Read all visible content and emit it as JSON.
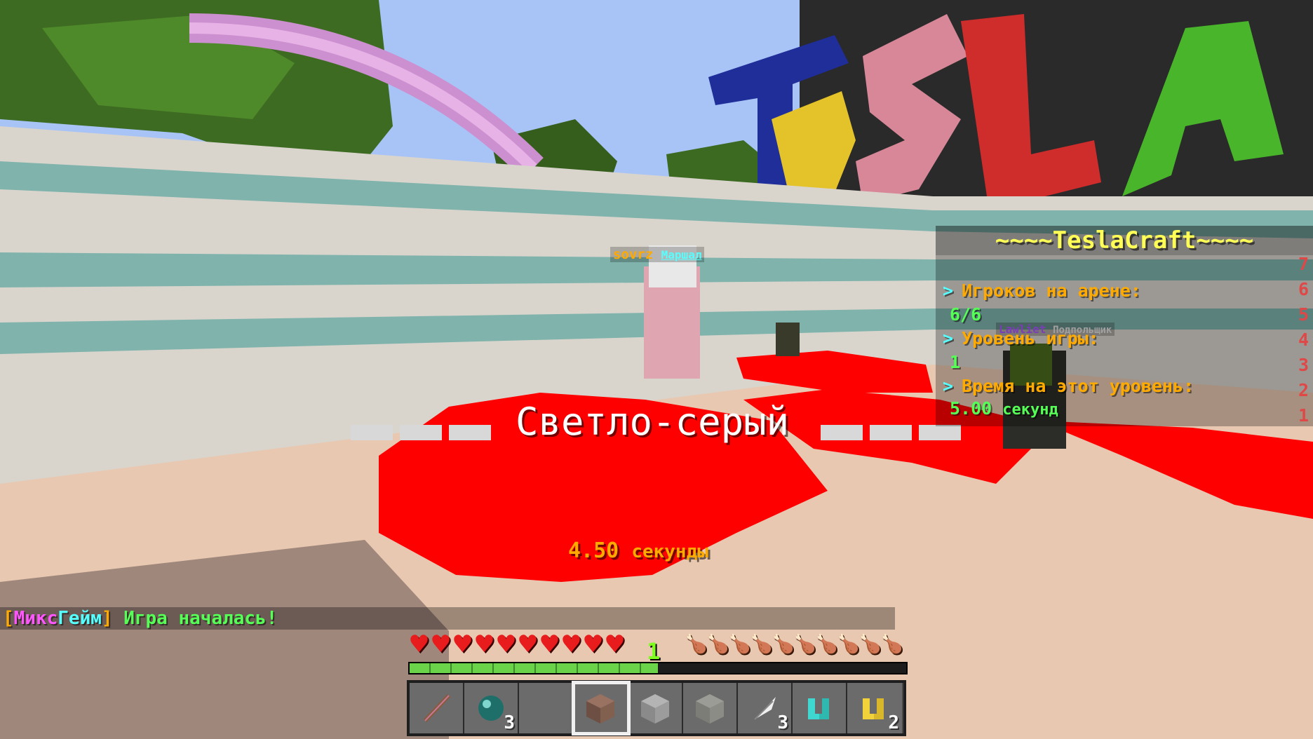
{
  "world": {
    "nametags": {
      "player1_name": "sovrz",
      "player1_title": "Маршал",
      "player2_name": "Lawliet",
      "player2_title": "Подпольщик"
    }
  },
  "title_overlay": {
    "color_title": "Светло-серый",
    "timer_value": "4.50",
    "timer_unit": "секунды"
  },
  "scoreboard": {
    "title": "~~~~TeslaCraft~~~~",
    "lines": [
      {
        "text": "Игроков на арене:",
        "score": "7",
        "arrow": true
      },
      {
        "text": "6/6",
        "score": "6",
        "arrow": false
      },
      {
        "text": "Уровень игры:",
        "score": "5",
        "arrow": true
      },
      {
        "text": "1",
        "score": "4",
        "arrow": false
      },
      {
        "text": "Время на этот уровень:",
        "score": "3",
        "arrow": true
      },
      {
        "text_value": "5.00",
        "text_unit": "секунд",
        "score": "2",
        "arrow": false
      },
      {
        "text": "",
        "score": "1",
        "arrow": false
      }
    ]
  },
  "chat": {
    "prefix_open": "[",
    "prefix_part1": "Микс",
    "prefix_part2": "Гейм",
    "prefix_close": "]",
    "message": " Игра началась!"
  },
  "hud": {
    "hearts": 10,
    "food": 10,
    "xp_level": "1",
    "xp_progress": 0.5,
    "hotbar": [
      {
        "item": "stick",
        "count": ""
      },
      {
        "item": "ender-pearl",
        "count": "3"
      },
      {
        "item": "empty",
        "count": ""
      },
      {
        "item": "brown-terracotta",
        "count": "",
        "selected": true
      },
      {
        "item": "stone-block",
        "count": ""
      },
      {
        "item": "light-gray-block",
        "count": ""
      },
      {
        "item": "feather",
        "count": "3"
      },
      {
        "item": "diamond-boots",
        "count": ""
      },
      {
        "item": "gold-boots",
        "count": "2"
      }
    ]
  },
  "colors": {
    "scoreboard_title": "#ffff55",
    "scoreboard_text": "#ffaa00",
    "scoreboard_value": "#55ff55",
    "chat_bracket": "#ffaa00",
    "chat_mix": "#ff55ff",
    "chat_game": "#55ffff",
    "chat_message": "#55ff55",
    "timer": "#ffaa00"
  }
}
